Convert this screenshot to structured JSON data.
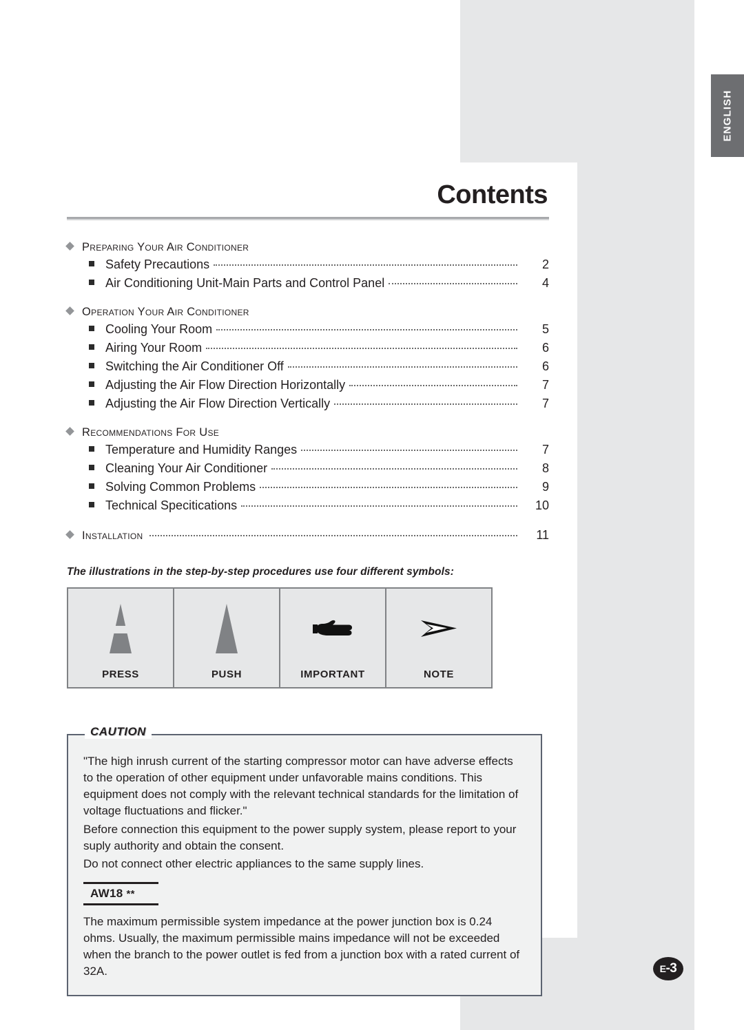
{
  "page": {
    "title": "Contents",
    "language_tab": "ENGLISH",
    "page_number": "E-3",
    "page_number_prefix": "E",
    "page_number_suffix": "-3",
    "accent_gray": "#e6e7e8",
    "tab_gray": "#6d6e71",
    "rule_gray": "#a7a9ac",
    "text_color": "#231f20"
  },
  "toc": {
    "groups": [
      {
        "section": "Preparing Your Air Conditioner",
        "bullet": "diamond-bullet",
        "entries": [
          {
            "label": "Safety Precautions",
            "page": "2"
          },
          {
            "label": "Air Conditioning Unit-Main Parts and Control Panel",
            "page": "4"
          }
        ]
      },
      {
        "section": "Operation Your Air Conditioner",
        "bullet": "diamond-bullet",
        "entries": [
          {
            "label": "Cooling Your Room",
            "page": "5"
          },
          {
            "label": "Airing Your Room",
            "page": "6"
          },
          {
            "label": "Switching the Air Conditioner Off",
            "page": "6"
          },
          {
            "label": "Adjusting the Air Flow Direction Horizontally",
            "page": "7"
          },
          {
            "label": "Adjusting the Air Flow Direction Vertically",
            "page": "7"
          }
        ]
      },
      {
        "section": "Recommendations For Use",
        "bullet": "diamond-bullet",
        "entries": [
          {
            "label": "Temperature and Humidity Ranges",
            "page": "7"
          },
          {
            "label": "Cleaning Your Air Conditioner",
            "page": "8"
          },
          {
            "label": "Solving Common Problems",
            "page": "9"
          },
          {
            "label": "Technical Specitications",
            "page": "10"
          }
        ]
      }
    ],
    "installation": {
      "section": "Installation",
      "page": "11"
    }
  },
  "symbols": {
    "intro": "The illustrations in the step-by-step procedures use four different symbols:",
    "items": [
      {
        "label": "PRESS",
        "icon": "press-triangle-icon"
      },
      {
        "label": "PUSH",
        "icon": "push-triangle-icon"
      },
      {
        "label": "IMPORTANT",
        "icon": "pointing-hand-icon"
      },
      {
        "label": "NOTE",
        "icon": "arrow-head-icon"
      }
    ]
  },
  "caution": {
    "tag": "CAUTION",
    "paragraphs": [
      "\"The high inrush current of the starting compressor motor can have adverse effects to the operation of other equipment under unfavorable mains conditions. This equipment does not comply with the relevant technical standards for the limitation of voltage fluctuations and flicker.\"",
      "Before connection this equipment to the power supply system, please report to your suply authority and obtain the consent.",
      "Do not connect other electric appliances to the same supply lines."
    ],
    "model": "AW18",
    "model_stars": "**",
    "model_paragraph": "The maximum permissible system impedance at the power junction box is 0.24 ohms. Usually, the maximum permissible mains impedance will not be exceeded when the branch to the power outlet is fed from a junction box with a rated current of 32A."
  }
}
